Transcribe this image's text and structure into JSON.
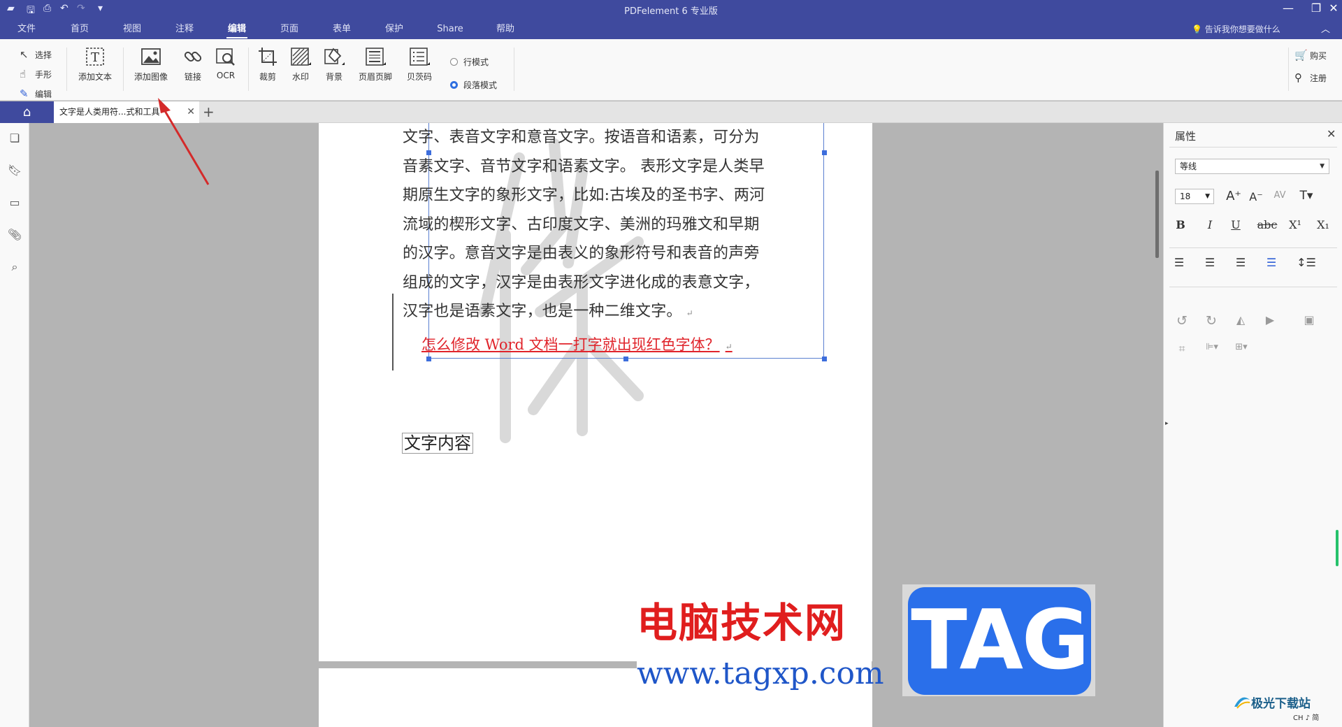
{
  "app": {
    "title": "PDFelement  6 专业版",
    "quick_access": [
      "save-icon",
      "print-icon",
      "undo-icon",
      "redo-icon",
      "customize-icon"
    ]
  },
  "menu": {
    "items": [
      "文件",
      "首页",
      "视图",
      "注释",
      "编辑",
      "页面",
      "表单",
      "保护",
      "Share",
      "帮助"
    ],
    "active": "编辑",
    "help_search": "告诉我你想要做什么"
  },
  "ribbon": {
    "modes": [
      "选择",
      "手形",
      "编辑"
    ],
    "tools": {
      "add_text": "添加文本",
      "add_image": "添加图像",
      "link": "链接",
      "ocr": "OCR",
      "crop": "裁剪",
      "watermark": "水印",
      "background": "背景",
      "header_footer": "页眉页脚",
      "bates": "贝茨码"
    },
    "line_mode": "行模式",
    "paragraph_mode": "段落模式",
    "buy": "购买",
    "register": "注册"
  },
  "tabs": {
    "doc_tab": "文字是人类用符...式和工具"
  },
  "document": {
    "paragraph_lines": [
      "文字、表音文字和意音文字。按语音和语素，可分为",
      "音素文字、音节文字和语素文字。 表形文字是人类早",
      "期原生文字的象形文字，比如:古埃及的圣书字、两河",
      "流域的楔形文字、古印度文字、美洲的玛雅文和早期",
      "的汉字。意音文字是由表义的象形符号和表音的声旁",
      "组成的文字，汉字是由表形文字进化成的表意文字，",
      "汉字也是语素文字，也是一种二维文字。"
    ],
    "red_line": "怎么修改 Word 文档一打字就出现红色字体？",
    "text_box": "文字内容"
  },
  "properties": {
    "title": "属性",
    "font": "等线",
    "size": "18"
  },
  "overlay": {
    "site_cn": "电脑技术网",
    "site_url": "www.tagxp.com",
    "tag": "TAG",
    "corner_brand": "极光下载站",
    "corner_ime": "CH ♪ 简"
  },
  "colors": {
    "accent": "#3f4a9e",
    "red_text": "#e0242b",
    "selection": "#3c6ddc"
  }
}
